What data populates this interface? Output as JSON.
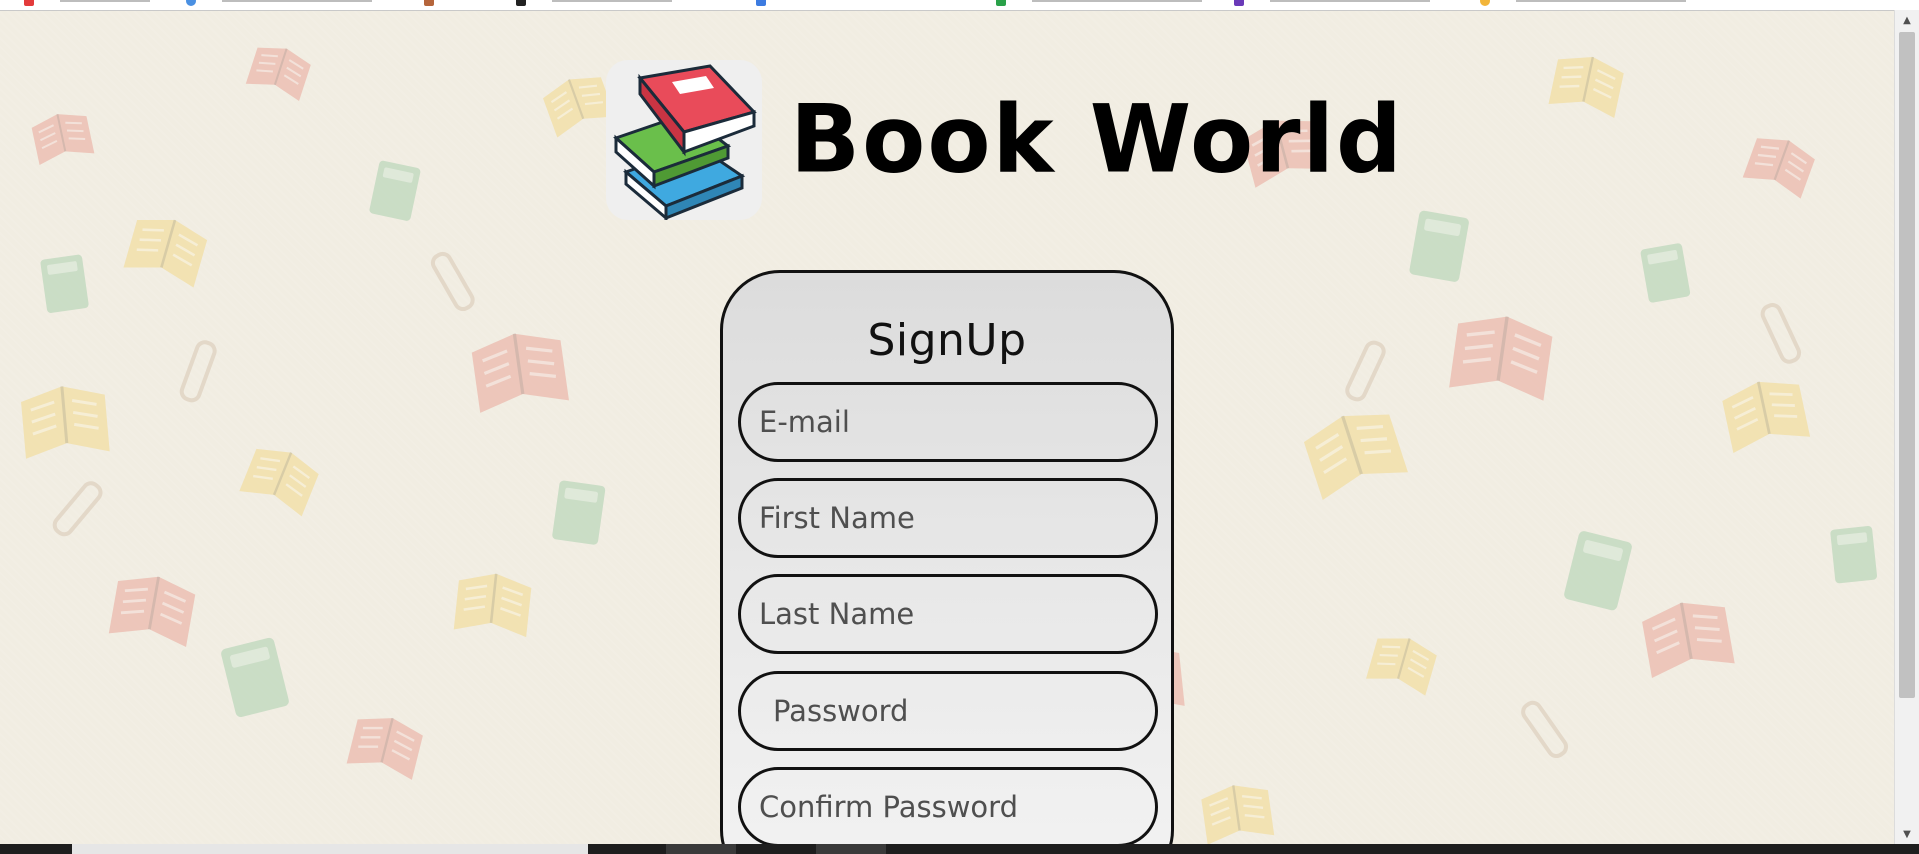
{
  "site": {
    "title": "Book World",
    "logo_icon": "book-stack-icon"
  },
  "form": {
    "heading": "SignUp",
    "email_placeholder": "E-mail",
    "first_name_placeholder": "First Name",
    "last_name_placeholder": "Last Name",
    "password_placeholder": "Password",
    "confirm_password_placeholder": "Confirm Password"
  },
  "colors": {
    "background": "#f1ede2",
    "card": "#e3e3e3",
    "border": "#111111",
    "logo_top_book": "#e94b5a",
    "logo_mid_book": "#6abf4b",
    "logo_low_book": "#3fa9e0"
  }
}
